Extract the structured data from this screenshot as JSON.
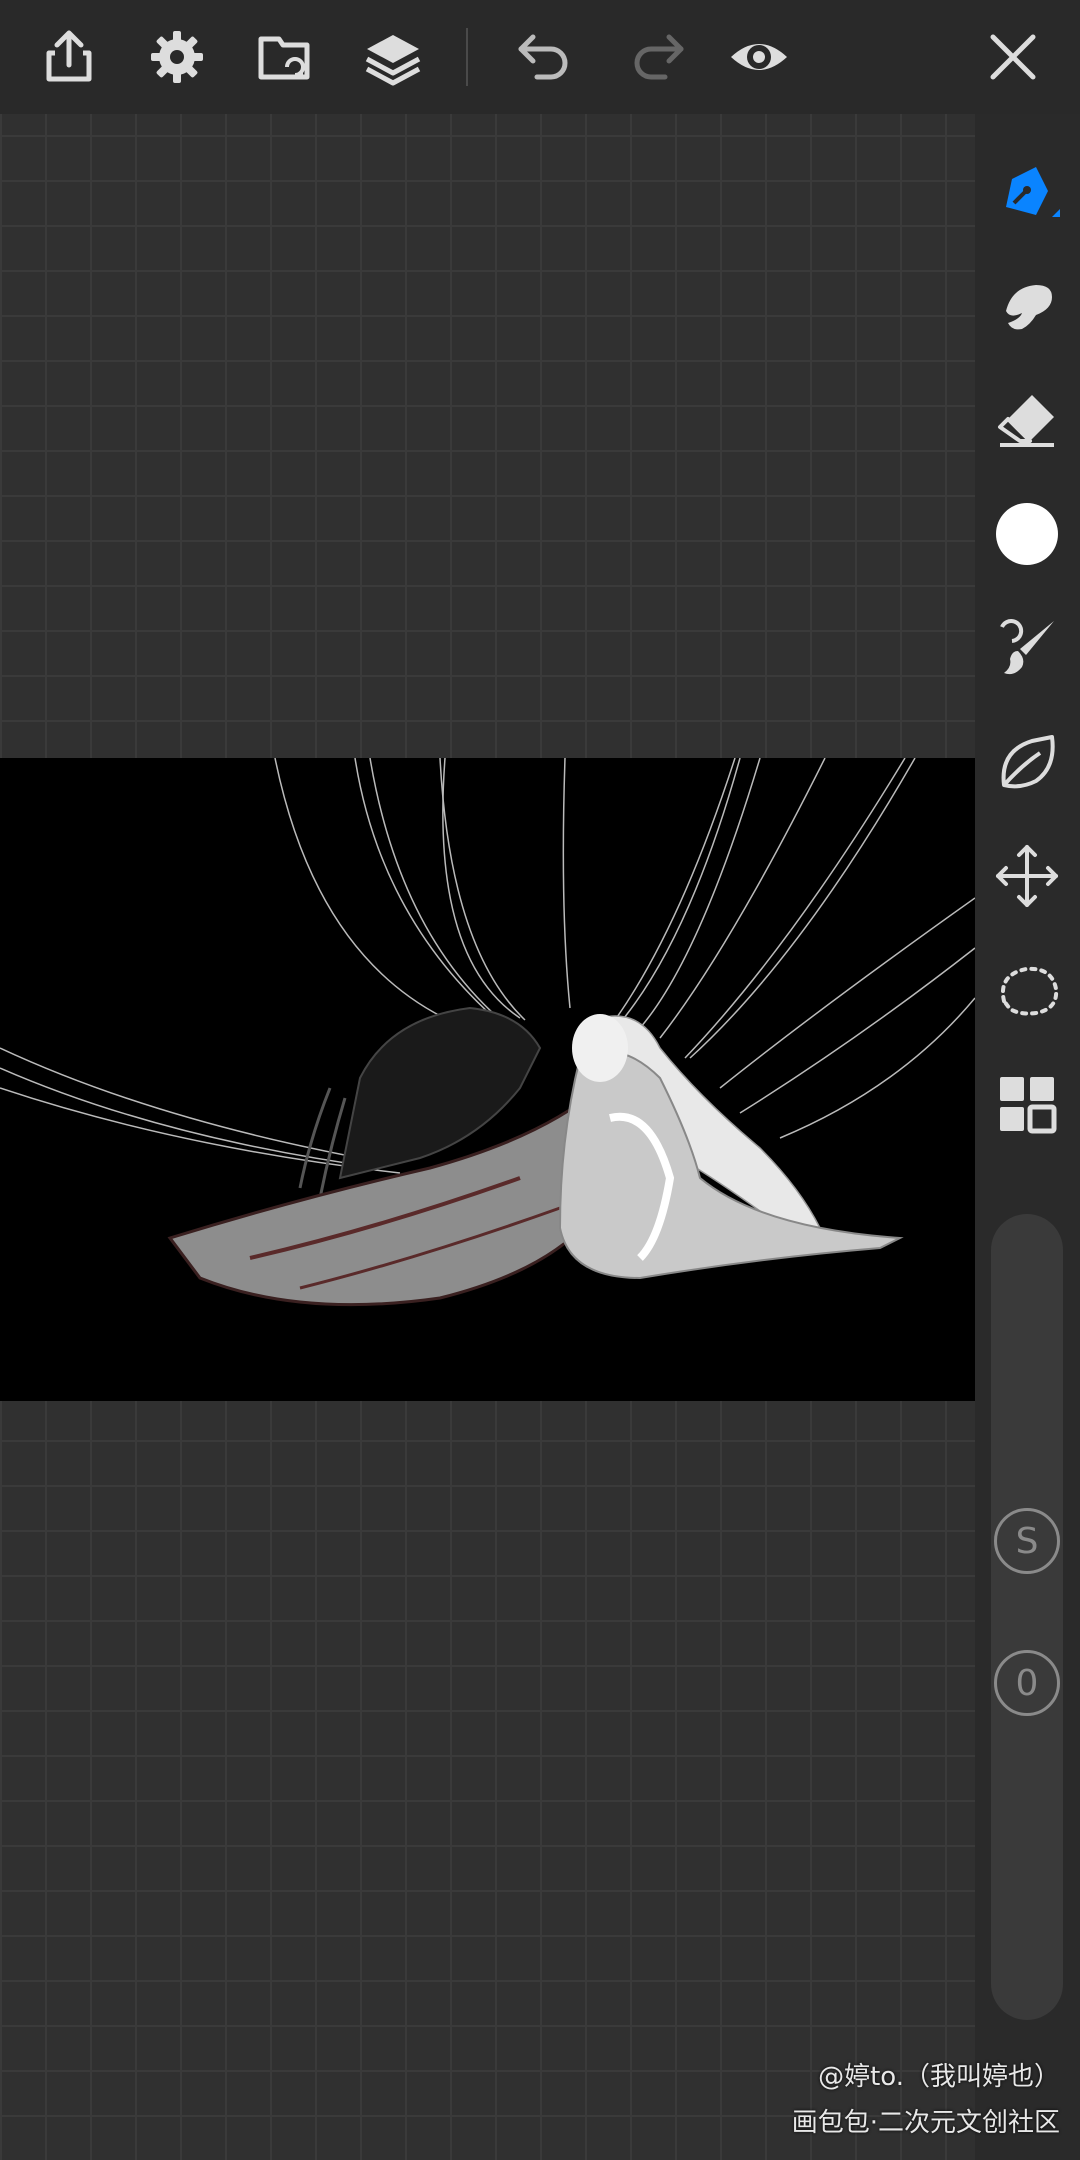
{
  "toolbar": {
    "icons": [
      "share-icon",
      "settings-icon",
      "import-icon",
      "layers-icon",
      "undo-icon",
      "redo-icon",
      "preview-eye-icon",
      "close-icon"
    ]
  },
  "sidebar": {
    "tools": [
      "pen-icon",
      "smudge-icon",
      "eraser-icon",
      "color-swatch",
      "brush-icon",
      "brush-library-icon",
      "move-transform-icon",
      "lasso-select-icon",
      "gallery-grid-icon"
    ],
    "active_color": "#0a84ff",
    "selected_color": "#ffffff",
    "size_knob_label": "S",
    "opacity_knob_label": "0"
  },
  "watermark": {
    "line1": "@婷to.（我叫婷也）",
    "line2": "画包包·二次元文创社区"
  }
}
